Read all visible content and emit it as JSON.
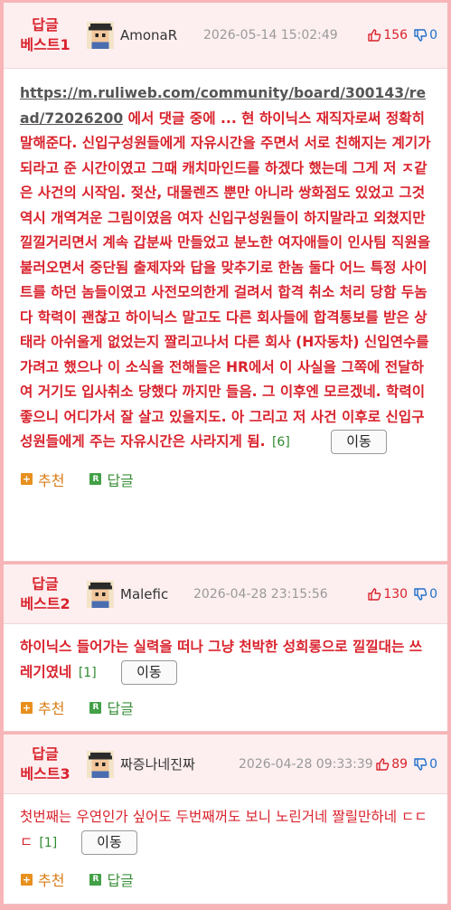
{
  "comments": [
    {
      "best_line1": "답글",
      "best_line2": "베스트1",
      "nickname": "AmonaR",
      "date": "2026-05-14 15:02:49",
      "likes": "156",
      "dislikes": "0",
      "link": "https://m.ruliweb.com/community/board/300143/read/72026200",
      "text": " 에서 댓글 중에 ... 현 하이닉스 재직자로써 정확히 말해준다. 신입구성원들에게 자유시간을 주면서 서로 친해지는 계기가 되라고 준 시간이였고 그때 캐치마인드를 하겠다 했는데 그게 저 ㅈ같은 사건의 시작임. 젖산, 대물렌즈 뿐만 아니라 쌍화점도 있었고 그것 역시 개역겨운 그림이였음 여자 신입구성원들이 하지말라고 외쳤지만 낄낄거리면서 계속 갑분싸 만들었고 분노한 여자애들이 인사팀 직원을 불러오면서 중단됨 출제자와 답을 맞추기로 한놈 둘다 어느 특정 사이트를 하던 놈들이였고 사전모의한게 걸려서 합격 취소 처리 당함 두놈다 학력이 괜찮고 하이닉스 말고도 다른 회사들에 합격통보를 받은 상태라 아쉬울게 없었는지 짤리고나서 다른 회사 (H자동차) 신입연수를 가려고 했으나 이 소식을 전해들은 HR에서 이 사실을 그쪽에 전달하여 거기도 입사취소 당했다 까지만 들음. 그 이후엔 모르겠네. 학력이 좋으니 어디가서 잘 살고 있을지도. 아 그리고 저 사건 이후로 신입구성원들에게 주는 자유시간은 사라지게 됨.",
      "reply_count": "[6]",
      "move_label": "이동",
      "recommend_label": "추천",
      "reply_label": "답글"
    },
    {
      "best_line1": "답글",
      "best_line2": "베스트2",
      "nickname": "Malefic",
      "date": "2026-04-28 23:15:56",
      "likes": "130",
      "dislikes": "0",
      "text": "하이닉스 들어가는 실력을 떠나 그냥 천박한 성희롱으로 낄낄대는 쓰레기였네",
      "reply_count": "[1]",
      "move_label": "이동",
      "recommend_label": "추천",
      "reply_label": "답글"
    },
    {
      "best_line1": "답글",
      "best_line2": "베스트3",
      "nickname": "짜증나네진짜",
      "date": "2026-04-28 09:33:39",
      "likes": "89",
      "dislikes": "0",
      "text": "첫번째는 우연인가 싶어도 두번째꺼도 보니 노린거네 짤릴만하네 ㄷㄷㄷ",
      "reply_count": "[1]",
      "move_label": "이동",
      "recommend_label": "추천",
      "reply_label": "답글"
    }
  ],
  "colors": {
    "accent_red": "#d9232d",
    "page_background": "#f7b5b8",
    "header_background": "#fdeff0",
    "dislike_blue": "#1e6fc9",
    "reply_count_green": "#2f8a2f",
    "recommend_orange": "#e8901e",
    "reply_green": "#43a047"
  },
  "icons": {
    "avatar": "pixel-avatar-icon",
    "like": "thumbs-up-icon",
    "dislike": "thumbs-down-icon",
    "recommend": "plus-box-icon",
    "reply": "r-box-icon"
  }
}
